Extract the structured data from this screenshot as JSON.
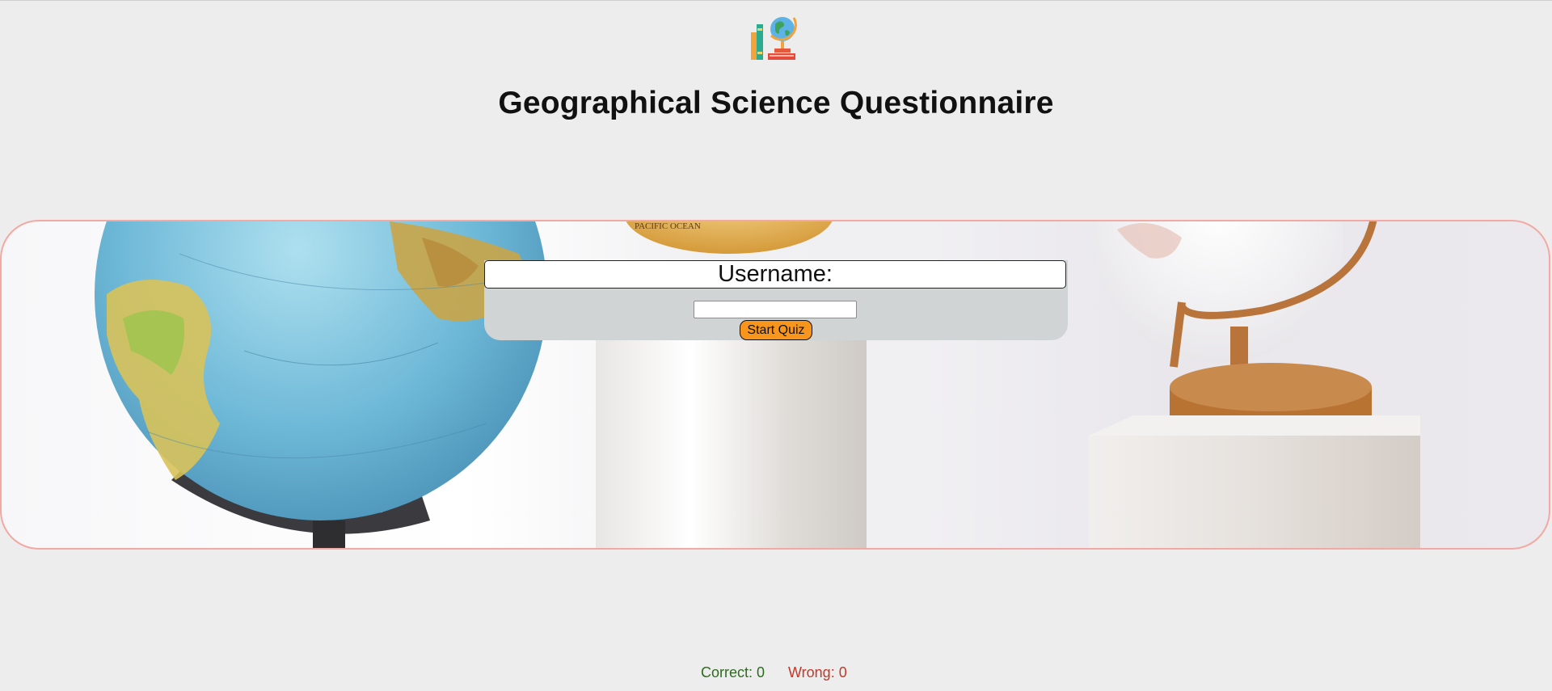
{
  "header": {
    "title": "Geographical Science Questionnaire",
    "logo_icon": "books-and-globe-icon"
  },
  "form": {
    "username_label": "Username:",
    "username_value": "",
    "username_placeholder": "",
    "start_button_label": "Start Quiz"
  },
  "score": {
    "correct_text": "Correct: 0",
    "wrong_text": "Wrong: 0"
  },
  "banner": {
    "image_description_icon": "globes-photo",
    "ocean_text": "PACIFIC OCEAN"
  },
  "colors": {
    "background": "#ededed",
    "banner_border": "#f3a9a3",
    "button": "#f7951d",
    "correct": "#2d6a1f",
    "wrong": "#c0392b"
  }
}
